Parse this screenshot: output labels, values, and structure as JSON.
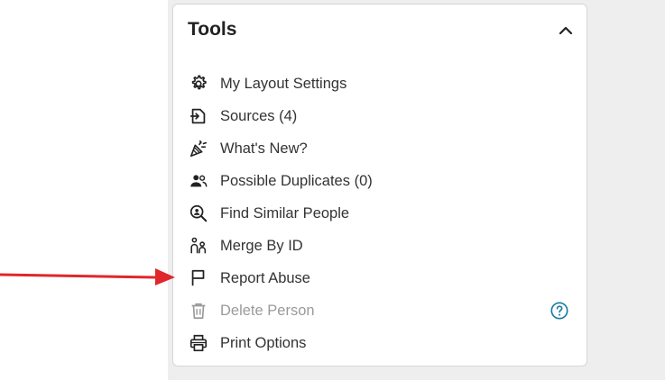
{
  "panel": {
    "title": "Tools",
    "collapse_icon": "chevron-up-icon"
  },
  "menu": {
    "items": [
      {
        "label": "My Layout Settings",
        "icon": "gear-icon"
      },
      {
        "label": "Sources (4)",
        "icon": "source-document-icon"
      },
      {
        "label": "What's New?",
        "icon": "party-popper-icon"
      },
      {
        "label": "Possible Duplicates (0)",
        "icon": "people-icon"
      },
      {
        "label": "Find Similar People",
        "icon": "person-search-icon"
      },
      {
        "label": "Merge By ID",
        "icon": "family-icon"
      },
      {
        "label": "Report Abuse",
        "icon": "flag-icon"
      },
      {
        "label": "Delete Person",
        "icon": "trash-icon",
        "disabled": true,
        "help_icon": "question-circle-icon"
      },
      {
        "label": "Print Options",
        "icon": "printer-icon"
      }
    ]
  },
  "annotation": {
    "arrow_color": "#e0262b",
    "icon": "red-arrow-icon"
  },
  "colors": {
    "text": "#333333",
    "disabled_text": "#9a9a9a",
    "help_icon": "#1a7aa0",
    "background": "#eeeeee"
  }
}
